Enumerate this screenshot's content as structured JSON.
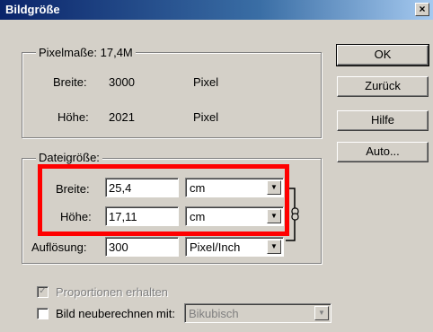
{
  "window": {
    "title": "Bildgröße",
    "close_glyph": "×"
  },
  "pixel_dimensions": {
    "label": "Pixelmaße: 17,4M",
    "width_label": "Breite:",
    "width_value": "3000",
    "width_unit": "Pixel",
    "height_label": "Höhe:",
    "height_value": "2021",
    "height_unit": "Pixel"
  },
  "document_size": {
    "label": "Dateigröße:",
    "width_label": "Breite:",
    "width_value": "25,4",
    "width_unit": "cm",
    "height_label": "Höhe:",
    "height_value": "17,11",
    "height_unit": "cm",
    "resolution_label": "Auflösung:",
    "resolution_value": "300",
    "resolution_unit": "Pixel/Inch"
  },
  "options": {
    "constrain_label": "Proportionen erhalten",
    "constrain_checked": true,
    "resample_label": "Bild neuberechnen mit:",
    "resample_checked": false,
    "resample_method": "Bikubisch"
  },
  "buttons": {
    "ok": "OK",
    "reset": "Zurück",
    "help": "Hilfe",
    "auto": "Auto..."
  },
  "colors": {
    "highlight": "#ff0000",
    "dialog_bg": "#d4d0c8"
  }
}
